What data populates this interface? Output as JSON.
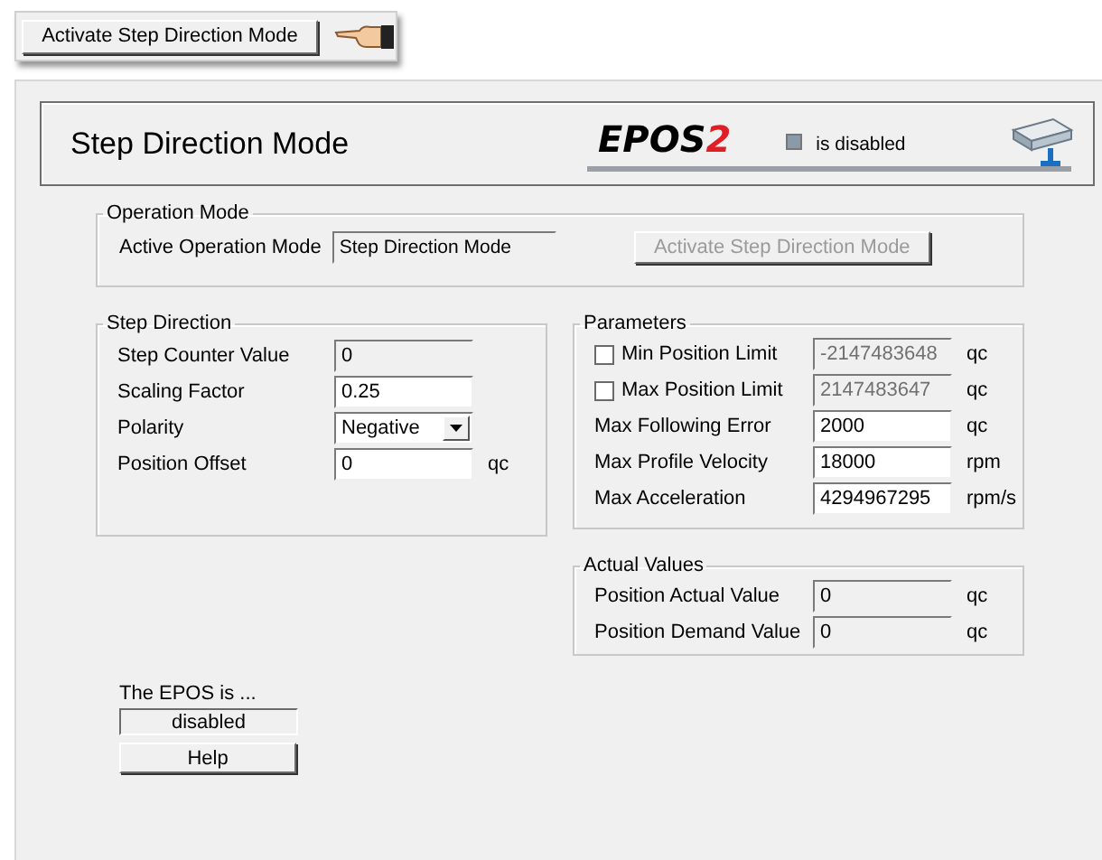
{
  "callout": {
    "button": "Activate Step Direction Mode"
  },
  "header": {
    "title": "Step Direction Mode",
    "logo": "EPOS",
    "logo_digit": "2",
    "status": "is disabled",
    "enabled": false
  },
  "operation_mode": {
    "title": "Operation Mode",
    "label": "Active Operation Mode",
    "value": "Step Direction Mode",
    "button": "Activate Step Direction Mode",
    "button_disabled": true
  },
  "step_direction": {
    "title": "Step Direction",
    "rows": [
      {
        "kind": "readonly",
        "label": "Step Counter Value",
        "value": "0"
      },
      {
        "kind": "input",
        "label": "Scaling Factor",
        "value": "0.25"
      },
      {
        "kind": "dropdown",
        "label": "Polarity",
        "value": "Negative"
      },
      {
        "kind": "input",
        "label": "Position Offset",
        "value": "0",
        "unit": "qc"
      }
    ]
  },
  "parameters": {
    "title": "Parameters",
    "rows": [
      {
        "kind": "checkbox",
        "label": "Min Position Limit",
        "checked": false,
        "value": "-2147483648",
        "unit": "qc"
      },
      {
        "kind": "checkbox",
        "label": "Max Position Limit",
        "checked": false,
        "value": "2147483647",
        "unit": "qc"
      },
      {
        "kind": "input",
        "label": "Max Following Error",
        "value": "2000",
        "unit": "qc"
      },
      {
        "kind": "input",
        "label": "Max Profile Velocity",
        "value": "18000",
        "unit": "rpm"
      },
      {
        "kind": "input",
        "label": "Max Acceleration",
        "value": "4294967295",
        "unit": "rpm/s"
      }
    ]
  },
  "actual_values": {
    "title": "Actual Values",
    "rows": [
      {
        "kind": "readonly",
        "label": "Position Actual Value",
        "value": "0",
        "unit": "qc"
      },
      {
        "kind": "readonly",
        "label": "Position Demand Value",
        "value": "0",
        "unit": "qc"
      }
    ]
  },
  "footer": {
    "label": "The EPOS is ...",
    "status": "disabled",
    "help": "Help"
  }
}
